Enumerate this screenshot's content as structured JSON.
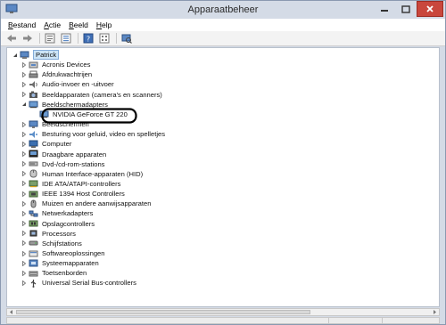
{
  "window": {
    "title": "Apparaatbeheer"
  },
  "menu": [
    {
      "label": "Bestand"
    },
    {
      "label": "Actie"
    },
    {
      "label": "Beeld"
    },
    {
      "label": "Help"
    }
  ],
  "toolbar": [
    {
      "icon": "back-arrow-icon"
    },
    {
      "icon": "forward-arrow-icon"
    },
    {
      "icon": "properties-icon"
    },
    {
      "icon": "list-view-icon"
    },
    {
      "icon": "help-icon"
    },
    {
      "icon": "view-options-icon"
    },
    {
      "icon": "scan-hardware-icon"
    }
  ],
  "tree": {
    "root": "Patrick",
    "items": [
      {
        "label": "Acronis Devices",
        "icon": "device-icon"
      },
      {
        "label": "Afdrukwachtrijen",
        "icon": "printer-icon"
      },
      {
        "label": "Audio-invoer en -uitvoer",
        "icon": "speaker-icon"
      },
      {
        "label": "Beeldapparaten (camera's en scanners)",
        "icon": "camera-icon"
      },
      {
        "label": "Beeldschermadapters",
        "icon": "display-adapter-icon",
        "expanded": true
      },
      {
        "label": "NVIDIA GeForce GT 220",
        "icon": "display-adapter-icon",
        "child": true
      },
      {
        "label": "Beeldschermen",
        "icon": "monitor-icon"
      },
      {
        "label": "Besturing voor geluid, video en spelletjes",
        "icon": "sound-video-icon"
      },
      {
        "label": "Computer",
        "icon": "computer-icon"
      },
      {
        "label": "Draagbare apparaten",
        "icon": "portable-device-icon"
      },
      {
        "label": "Dvd-/cd-rom-stations",
        "icon": "disc-drive-icon"
      },
      {
        "label": "Human Interface-apparaten (HID)",
        "icon": "hid-icon"
      },
      {
        "label": "IDE ATA/ATAPI-controllers",
        "icon": "ide-controller-icon"
      },
      {
        "label": "IEEE 1394 Host Controllers",
        "icon": "ieee1394-icon"
      },
      {
        "label": "Muizen en andere aanwijsapparaten",
        "icon": "mouse-icon"
      },
      {
        "label": "Netwerkadapters",
        "icon": "network-icon"
      },
      {
        "label": "Opslagcontrollers",
        "icon": "storage-controller-icon"
      },
      {
        "label": "Processors",
        "icon": "processor-icon"
      },
      {
        "label": "Schijfstations",
        "icon": "disk-drive-icon"
      },
      {
        "label": "Softwareoplossingen",
        "icon": "software-icon"
      },
      {
        "label": "Systeemapparaten",
        "icon": "system-device-icon"
      },
      {
        "label": "Toetsenborden",
        "icon": "keyboard-icon"
      },
      {
        "label": "Universal Serial Bus-controllers",
        "icon": "usb-icon"
      }
    ]
  },
  "colors": {
    "highlight_circle": "#000000",
    "titlebar": "#d4dbe6",
    "close_button": "#c9473d"
  }
}
